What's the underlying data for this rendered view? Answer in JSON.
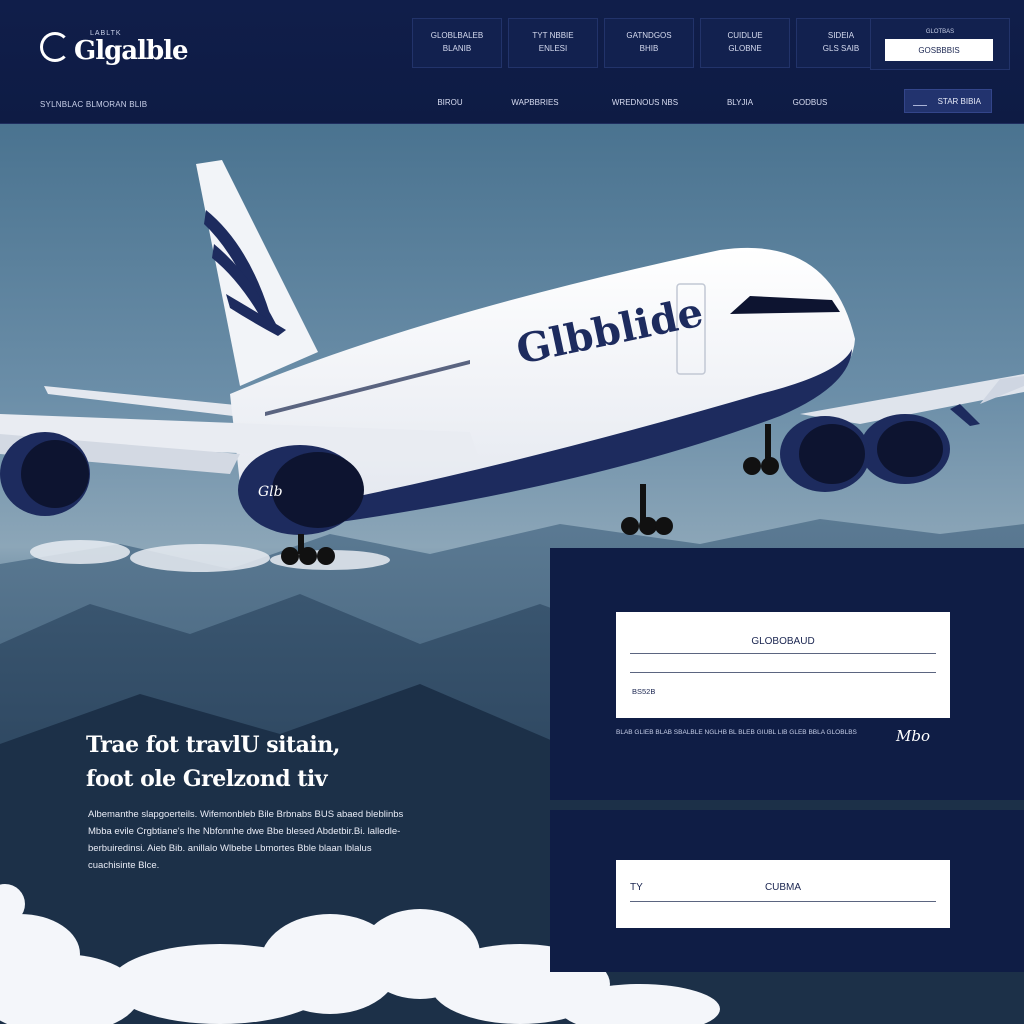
{
  "brand": {
    "name": "Glgalble",
    "sub": "LABLTK",
    "tagline": "SYLNBLAC BLMORAN BLIB"
  },
  "header": {
    "top_links": [
      {
        "line1": "GLOBLBALEB",
        "line2": "BLANIB"
      },
      {
        "line1": "TYT NBBIE",
        "line2": "ENLESI"
      },
      {
        "line1": "GATNDGOS",
        "line2": "BHIB"
      },
      {
        "line1": "CUIDLUE",
        "line2": "GLOBNE"
      },
      {
        "line1": "SIDEIA",
        "line2": "GLS SAIB"
      }
    ],
    "login_label": "GLOTBAS",
    "login_value": "GOSBBBIS",
    "nav": [
      "BIROU",
      "WAPBBRIES",
      "WREDNOUS NBS",
      "BLYJIA",
      "GODBUS"
    ],
    "signin": "STAR BIBIA"
  },
  "hero": {
    "title": "Trae fot travlU sitain,\nfoot ole Grelzond tiv",
    "body": "Albemanthe slapgoerteils. Wifemonbleb Bile Brbnabs BUS abaed bleblinbs Mbba evile Crgbtiane's Ihe Nbfonnhe dwe Bbe blesed Abdetbir.Bi. lalledle-berbuiredinsi. Aieb Bib. anillalo Wlbebe Lbmortes Bble blaan lblalus cuachisinte Blce."
  },
  "plane": {
    "livery": "Glbblide",
    "engine_text": "Glb"
  },
  "panel_1": {
    "card_title": "GLOBOBAUD",
    "card_small": "BS52B",
    "footer": "BLAB GLIEB BLAB SBALBLE NGLHB BL BLEB GIUBL LIB GLEB BBLA GLOBLBS",
    "signature": "Mbo"
  },
  "panel_2": {
    "left_label": "TY",
    "center_label": "CUBMA"
  },
  "colors": {
    "navy": "#0f1d45",
    "accent": "#22336e",
    "white": "#ffffff"
  }
}
